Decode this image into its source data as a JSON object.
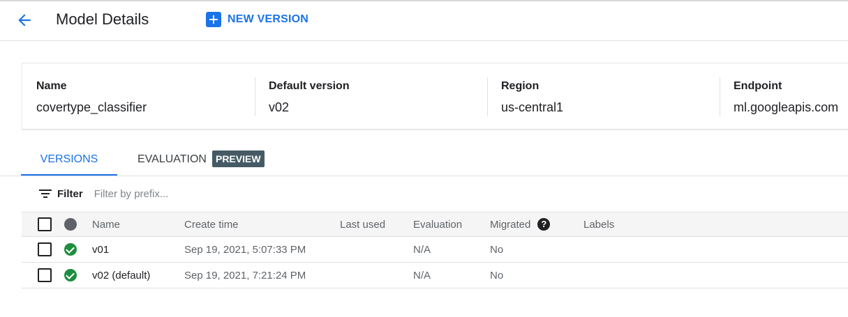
{
  "header": {
    "title": "Model Details",
    "new_version_label": "NEW VERSION"
  },
  "summary": {
    "fields": [
      {
        "label": "Name",
        "value": "covertype_classifier"
      },
      {
        "label": "Default version",
        "value": "v02"
      },
      {
        "label": "Region",
        "value": "us-central1"
      },
      {
        "label": "Endpoint",
        "value": "ml.googleapis.com"
      }
    ]
  },
  "tabs": [
    {
      "label": "VERSIONS",
      "active": true
    },
    {
      "label": "EVALUATION",
      "badge": "PREVIEW",
      "active": false
    }
  ],
  "filter": {
    "label": "Filter",
    "placeholder": "Filter by prefix..."
  },
  "table": {
    "columns": [
      "Name",
      "Create time",
      "Last used",
      "Evaluation",
      "Migrated",
      "Labels"
    ],
    "help_glyph": "?",
    "rows": [
      {
        "name": "v01",
        "create_time": "Sep 19, 2021, 5:07:33 PM",
        "last_used": "",
        "evaluation": "N/A",
        "migrated": "No",
        "labels": "",
        "status": "success"
      },
      {
        "name": "v02 (default)",
        "create_time": "Sep 19, 2021, 7:21:24 PM",
        "last_used": "",
        "evaluation": "N/A",
        "migrated": "No",
        "labels": "",
        "status": "success"
      }
    ]
  },
  "icons": {
    "back": "arrow-back-icon",
    "add": "add-box-icon",
    "filter": "filter-list-icon",
    "status": "check-circle-icon",
    "help": "help-icon"
  },
  "colors": {
    "accent": "#1a73e8",
    "success": "#1e8e3e",
    "badge_bg": "#455a64"
  }
}
